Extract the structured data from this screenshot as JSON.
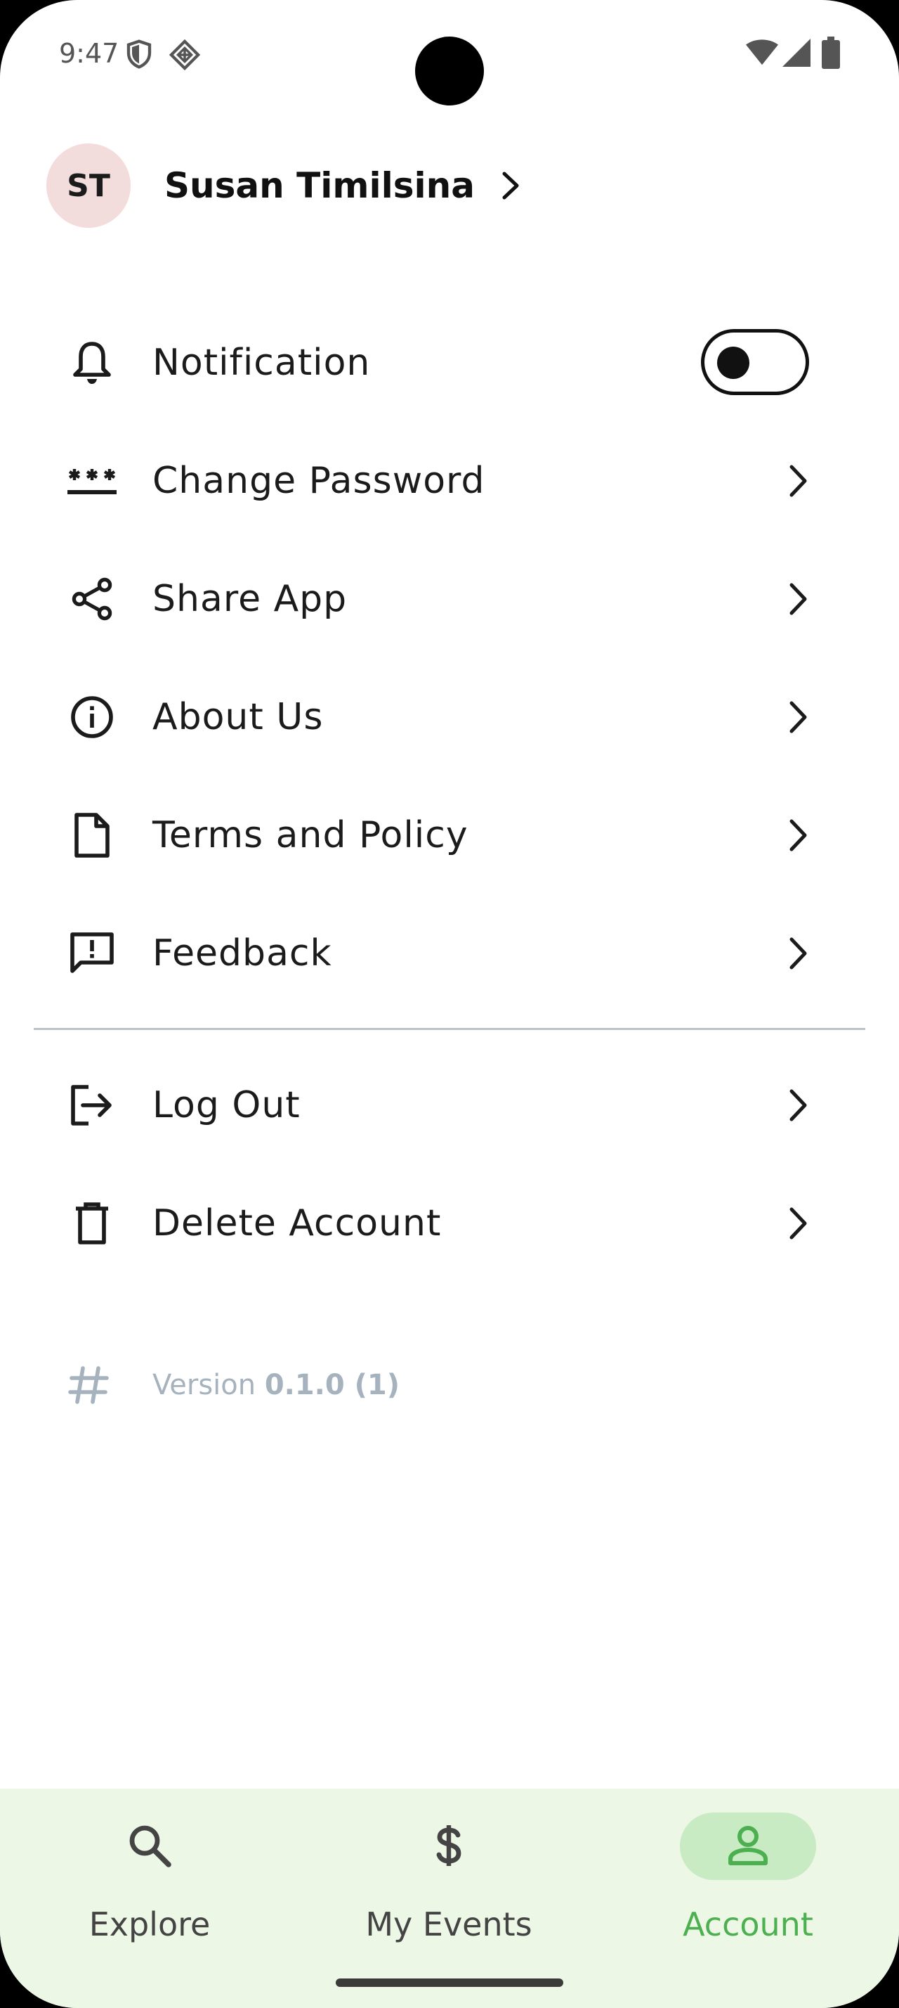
{
  "status_bar": {
    "time": "9:47"
  },
  "profile": {
    "initials": "ST",
    "name": "Susan Timilsina"
  },
  "menu": {
    "notification": {
      "label": "Notification",
      "enabled": false
    },
    "change_password": {
      "label": "Change Password"
    },
    "share_app": {
      "label": "Share App"
    },
    "about_us": {
      "label": "About Us"
    },
    "terms": {
      "label": "Terms and Policy"
    },
    "feedback": {
      "label": "Feedback"
    },
    "logout": {
      "label": "Log Out"
    },
    "delete_account": {
      "label": "Delete Account"
    }
  },
  "version": {
    "prefix": "Version",
    "number": "0.1.0 (1)"
  },
  "nav": {
    "items": [
      {
        "label": "Explore",
        "icon": "search-icon",
        "active": false
      },
      {
        "label": "My Events",
        "icon": "dollar-icon",
        "active": false
      },
      {
        "label": "Account",
        "icon": "person-icon",
        "active": true
      }
    ]
  },
  "colors": {
    "accent": "#4caf50",
    "nav_background": "#edf7e6",
    "active_pill": "#c9ebc3",
    "avatar_background": "#f3dcdc",
    "muted_text": "#a6b3bf"
  }
}
